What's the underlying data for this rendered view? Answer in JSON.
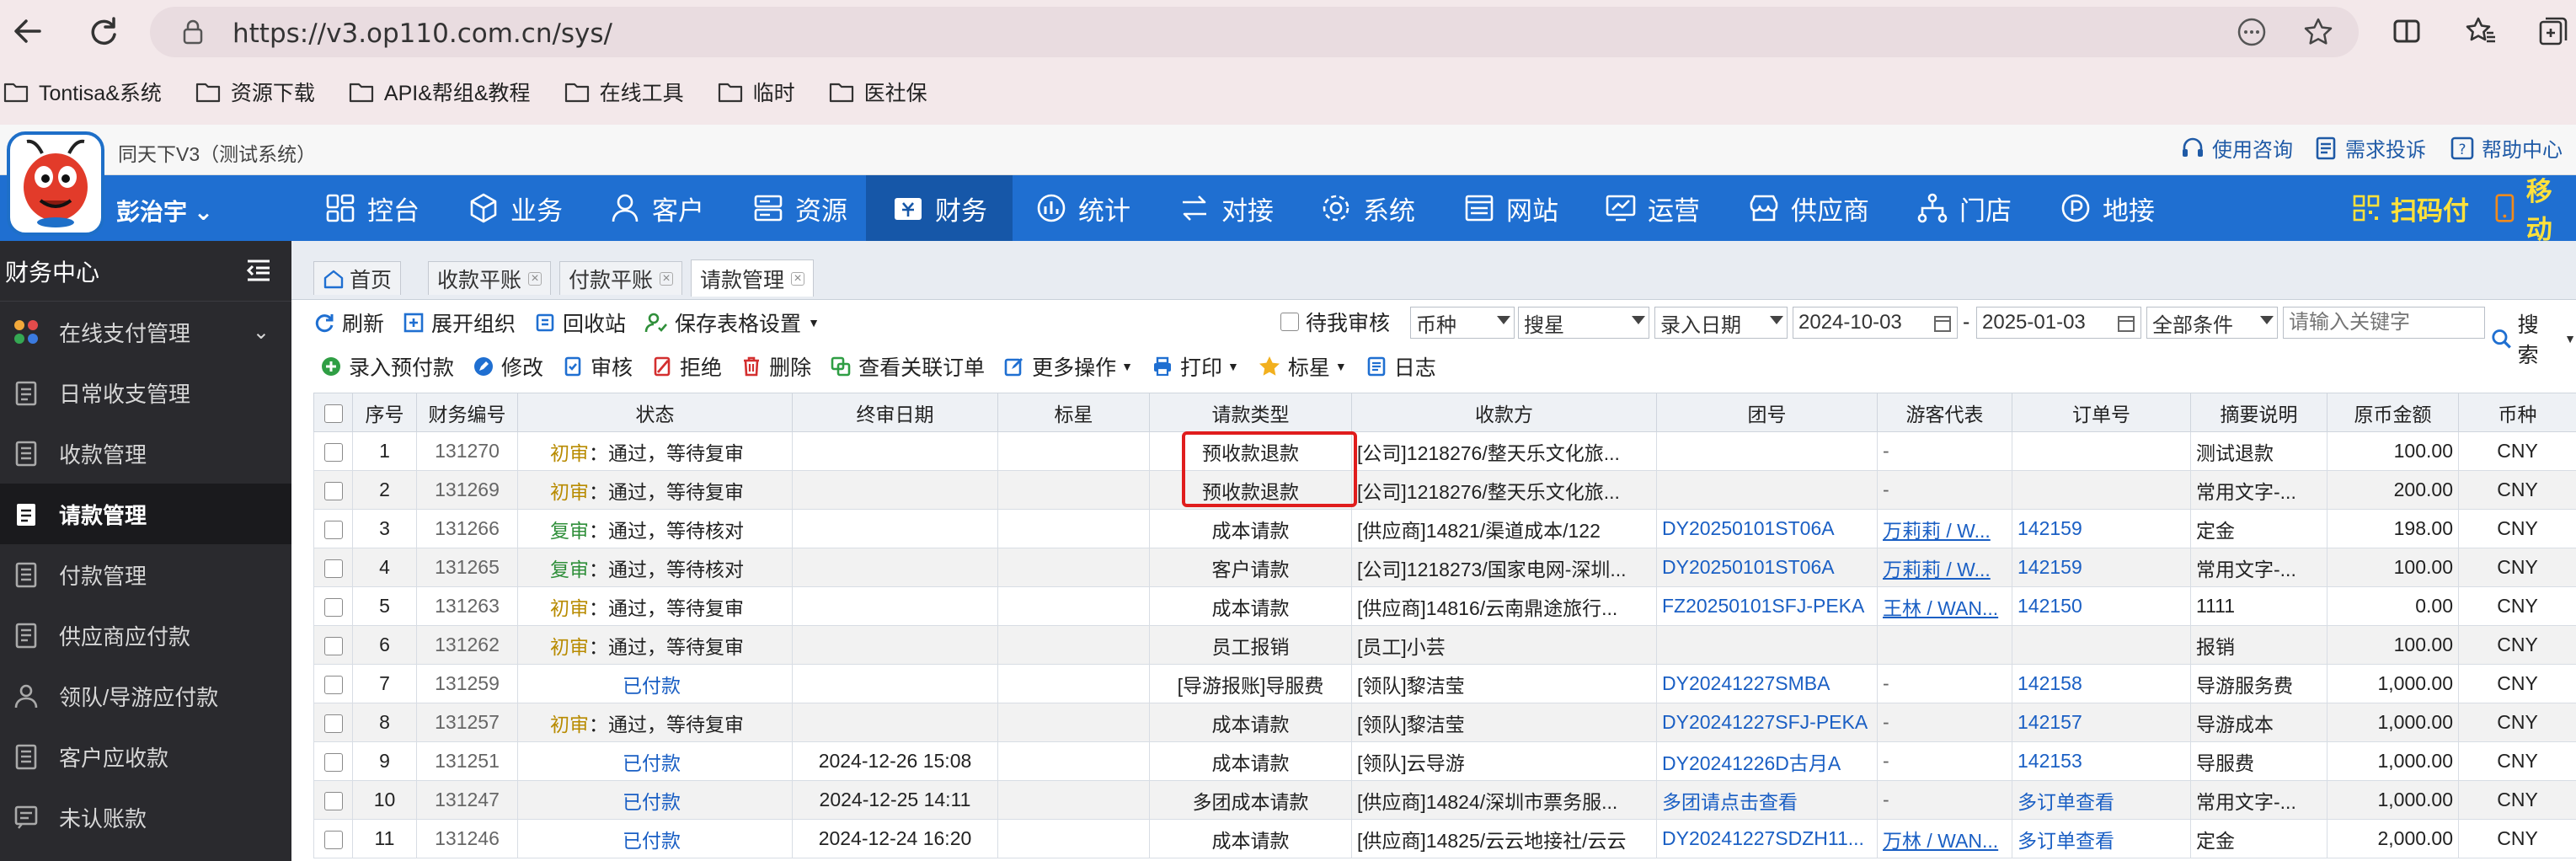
{
  "browser": {
    "url": "https://v3.op110.com.cn/sys/",
    "bookmarks": [
      "Tontisa&系统",
      "资源下载",
      "API&帮组&教程",
      "在线工具",
      "临时",
      "医社保"
    ]
  },
  "app": {
    "title": "同天下V3（测试系统）",
    "user": "彭治宇",
    "help_links": [
      "使用咨询",
      "需求投诉",
      "帮助中心"
    ],
    "nav": [
      "控台",
      "业务",
      "客户",
      "资源",
      "财务",
      "统计",
      "对接",
      "系统",
      "网站",
      "运营",
      "供应商",
      "门店",
      "地接"
    ],
    "nav_active": "财务",
    "nav_right": [
      "扫码付",
      "移动"
    ]
  },
  "sidebar": {
    "title": "财务中心",
    "items": [
      "在线支付管理",
      "日常收支管理",
      "收款管理",
      "请款管理",
      "付款管理",
      "供应商应付款",
      "领队/导游应付款",
      "客户应收款",
      "未认账款"
    ],
    "active": "请款管理"
  },
  "tabs": [
    "首页",
    "收款平账",
    "付款平账",
    "请款管理"
  ],
  "toolbar1": {
    "buttons": [
      "刷新",
      "展开组织",
      "回收站",
      "保存表格设置"
    ],
    "pending_label": "待我审核",
    "currency": "币种",
    "star": "搜星",
    "date_type": "录入日期",
    "date_from": "2024-10-03",
    "date_to": "2025-01-03",
    "condition": "全部条件",
    "keyword_placeholder": "请输入关键字",
    "search": "搜索"
  },
  "toolbar2": [
    "录入预付款",
    "修改",
    "审核",
    "拒绝",
    "删除",
    "查看关联订单",
    "更多操作",
    "打印",
    "标星",
    "日志"
  ],
  "table": {
    "headers": [
      "",
      "序号",
      "财务编号",
      "状态",
      "终审日期",
      "标星",
      "请款类型",
      "收款方",
      "团号",
      "游客代表",
      "订单号",
      "摘要说明",
      "原币金额",
      "币种"
    ],
    "rows": [
      {
        "no": "1",
        "id": "131270",
        "stage": "初审",
        "status": "：通过，等待复审",
        "date": "",
        "type": "预收款退款",
        "payee": "[公司]1218276/整天乐文化旅...",
        "group": "",
        "rep": "-",
        "order": "",
        "summary": "测试退款",
        "amount": "100.00",
        "cur": "CNY"
      },
      {
        "no": "2",
        "id": "131269",
        "stage": "初审",
        "status": "：通过，等待复审",
        "date": "",
        "type": "预收款退款",
        "payee": "[公司]1218276/整天乐文化旅...",
        "group": "",
        "rep": "-",
        "order": "",
        "summary": "常用文字-...",
        "amount": "200.00",
        "cur": "CNY"
      },
      {
        "no": "3",
        "id": "131266",
        "stage": "复审",
        "status": "：通过，等待核对",
        "date": "",
        "type": "成本请款",
        "payee": "[供应商]14821/渠道成本/122",
        "group": "DY20250101ST06A",
        "rep": "万莉莉 / W...",
        "order": "142159",
        "summary": "定金",
        "amount": "198.00",
        "cur": "CNY"
      },
      {
        "no": "4",
        "id": "131265",
        "stage": "复审",
        "status": "：通过，等待核对",
        "date": "",
        "type": "客户请款",
        "payee": "[公司]1218273/国家电网-深圳...",
        "group": "DY20250101ST06A",
        "rep": "万莉莉 / W...",
        "order": "142159",
        "summary": "常用文字-...",
        "amount": "100.00",
        "cur": "CNY"
      },
      {
        "no": "5",
        "id": "131263",
        "stage": "初审",
        "status": "：通过，等待复审",
        "date": "",
        "type": "成本请款",
        "payee": "[供应商]14816/云南鼎途旅行...",
        "group": "FZ20250101SFJ-PEKA",
        "rep": "王林 / WAN...",
        "order": "142150",
        "summary": "1111",
        "amount": "0.00",
        "cur": "CNY"
      },
      {
        "no": "6",
        "id": "131262",
        "stage": "初审",
        "status": "：通过，等待复审",
        "date": "",
        "type": "员工报销",
        "payee": "[员工]小芸",
        "group": "",
        "rep": "",
        "order": "",
        "summary": "报销",
        "amount": "100.00",
        "cur": "CNY"
      },
      {
        "no": "7",
        "id": "131259",
        "stage": "",
        "status": "已付款",
        "date": "",
        "type": "[导游报账]导服费",
        "payee": "[领队]黎洁莹",
        "group": "DY20241227SMBA",
        "rep": "-",
        "order": "142158",
        "summary": "导游服务费",
        "amount": "1,000.00",
        "cur": "CNY"
      },
      {
        "no": "8",
        "id": "131257",
        "stage": "初审",
        "status": "：通过，等待复审",
        "date": "",
        "type": "成本请款",
        "payee": "[领队]黎洁莹",
        "group": "DY20241227SFJ-PEKA",
        "rep": "-",
        "order": "142157",
        "summary": "导游成本",
        "amount": "1,000.00",
        "cur": "CNY"
      },
      {
        "no": "9",
        "id": "131251",
        "stage": "",
        "status": "已付款",
        "date": "2024-12-26 15:08",
        "type": "成本请款",
        "payee": "[领队]云导游",
        "group": "DY20241226D古月A",
        "rep": "-",
        "order": "142153",
        "summary": "导服费",
        "amount": "1,000.00",
        "cur": "CNY"
      },
      {
        "no": "10",
        "id": "131247",
        "stage": "",
        "status": "已付款",
        "date": "2024-12-25 14:11",
        "type": "多团成本请款",
        "payee": "[供应商]14824/深圳市票务服...",
        "group": "多团请点击查看",
        "rep": "-",
        "order": "多订单查看",
        "summary": "常用文字-...",
        "amount": "1,000.00",
        "cur": "CNY"
      },
      {
        "no": "11",
        "id": "131246",
        "stage": "",
        "status": "已付款",
        "date": "2024-12-24 16:20",
        "type": "成本请款",
        "payee": "[供应商]14825/云云地接社/云云",
        "group": "DY20241227SDZH11...",
        "rep": "万林 / WAN...",
        "order": "多订单查看",
        "summary": "定金",
        "amount": "2,000.00",
        "cur": "CNY"
      }
    ]
  },
  "colors": {
    "nav": "#1f6fd1",
    "sidebar": "#2a2a2e",
    "highlight": "#e01d1d",
    "link": "#1a5fc4"
  }
}
